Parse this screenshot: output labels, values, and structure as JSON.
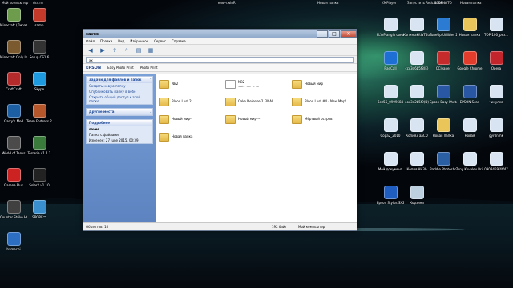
{
  "top_labels": [
    "Мой компьютер",
    "dsn.ru",
    "ключ.winR",
    "Новая папка",
    "KMPlayer",
    "Запустить Redcat Ser...",
    "100PHOTO",
    "Новая папка"
  ],
  "desktop_left": [
    {
      "label": "Minecraft (Пиратка)",
      "color": "#6d9c4d"
    },
    {
      "label": "samp",
      "color": "#c33a2a"
    },
    {
      "label": "Minecraft Only Lauycher",
      "color": "#7a5a2e"
    },
    {
      "label": "Setup CS1.6",
      "color": "#333"
    },
    {
      "label": "CraftCraft",
      "color": "#b52b2b"
    },
    {
      "label": "Skype",
      "color": "#1e9be0"
    },
    {
      "label": "Garry's Mod",
      "color": "#1d5fa3"
    },
    {
      "label": "Team Fortress 2",
      "color": "#b5562b"
    },
    {
      "label": "World of Tanks",
      "color": "#4b4b4b"
    },
    {
      "label": "Terraria v1.1.2",
      "color": "#3a7a3a"
    },
    {
      "label": "Garena Plus",
      "color": "#c22"
    },
    {
      "label": "Solar2 v1.10",
      "color": "#222"
    },
    {
      "label": "Counter Strike HQ 1.6 v.53",
      "color": "#404040"
    },
    {
      "label": "SPORE™",
      "color": "#3a8fce"
    },
    {
      "label": "hamachi",
      "color": "#2b6ec2"
    }
  ],
  "desktop_right": [
    {
      "label": "FLYeP angio соната",
      "color": "#d8e4f2"
    },
    {
      "label": "Копия akfdaT5twr",
      "color": "#d8e4f2"
    },
    {
      "label": "TuneUp Utilities 2012",
      "color": "#2c7bd3"
    },
    {
      "label": "Новая папка",
      "color": "#e9c55a"
    },
    {
      "label": "TOP-100_рез...",
      "color": "#d8e4f2"
    },
    {
      "label": "RadCall",
      "color": "#1e6fd4"
    },
    {
      "label": "ccc3d6b5f8(E)",
      "color": "#d8e4f2"
    },
    {
      "label": "CCleaner",
      "color": "#c62b2b"
    },
    {
      "label": "Google Chrome",
      "color": "#e23c2c"
    },
    {
      "label": "Opera",
      "color": "#c2262c"
    },
    {
      "label": "6ec55_0999684",
      "color": "#d8e4f2"
    },
    {
      "label": "eoc3d2b5f9(D)",
      "color": "#d8e4f2"
    },
    {
      "label": "Epson Easy Photo Print",
      "color": "#2a57a3"
    },
    {
      "label": "EPSON Scan",
      "color": "#2a57a3"
    },
    {
      "label": "чикулев",
      "color": "#d8e4f2"
    },
    {
      "label": "Copa2_2010",
      "color": "#d8e4f2"
    },
    {
      "label": "Копия3 aaCD",
      "color": "#d8e4f2"
    },
    {
      "label": "Новая папка",
      "color": "#e9c55a"
    },
    {
      "label": "Новая",
      "color": "#d8e4f2"
    },
    {
      "label": "gyr0nmk",
      "color": "#d8e4f2"
    },
    {
      "label": "Мой документ",
      "color": "#d8e4f2"
    },
    {
      "label": "Копия AH3b",
      "color": "#d8e4f2"
    },
    {
      "label": "Baddie Photoshop",
      "color": "#2b5fa3"
    },
    {
      "label": "Tony Kovalev Bring It Back",
      "color": "#d8e4f2"
    },
    {
      "label": "0908459f4ff47",
      "color": "#d8e4f2"
    },
    {
      "label": "Epson Stylus SX210_SX410",
      "color": "#1f5dc1"
    },
    {
      "label": "Корзина",
      "color": "#bcd0e0"
    }
  ],
  "window": {
    "title": "saves",
    "menu": [
      "Файл",
      "Правка",
      "Вид",
      "Избранное",
      "Сервис",
      "Справка"
    ],
    "address": "xx",
    "epson": {
      "brand": "EPSON",
      "btn1": "Easy Photo Print",
      "btn2": "Photo Print"
    },
    "tasks_header": "Задачи для файлов и папок",
    "tasks": [
      "Создать новую папку",
      "Опубликовать папку в вебе",
      "Открыть общий доступ к этой папке"
    ],
    "other_header": "Другие места",
    "details_header": "Подробнее",
    "details": [
      "saves",
      "Папка с файлами",
      "Изменен: 27 June 2015, 00:39"
    ],
    "items": [
      {
        "name": "NB2",
        "meta": "",
        "type": "folder"
      },
      {
        "name": "NB2",
        "meta": "Файл \"DAT\" 1 КБ",
        "type": "doc"
      },
      {
        "name": "Новый мир",
        "meta": "",
        "type": "folder"
      },
      {
        "name": "Blood Lust 2",
        "meta": "",
        "type": "folder"
      },
      {
        "name": "Cake Defense 2 FINAL",
        "meta": "",
        "type": "folder"
      },
      {
        "name": "Blood Lust #4 - New Map!",
        "meta": "",
        "type": "folder"
      },
      {
        "name": "Новый мир--",
        "meta": "",
        "type": "folder"
      },
      {
        "name": "Новый мир---",
        "meta": "",
        "type": "folder"
      },
      {
        "name": "Мёртвый остров",
        "meta": "",
        "type": "folder"
      },
      {
        "name": "Новая папка",
        "meta": "",
        "type": "folder"
      }
    ],
    "status_objects": "Объектов: 10",
    "status_size": "192 байт",
    "status_pc": "Мой компьютер"
  }
}
